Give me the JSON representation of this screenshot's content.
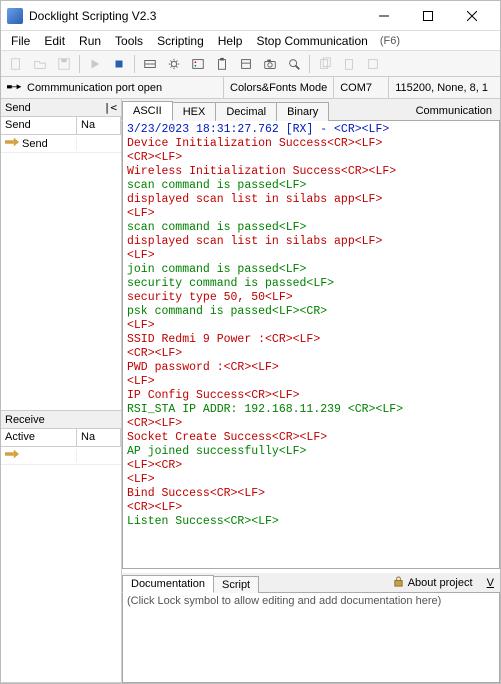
{
  "window": {
    "title": "Docklight Scripting V2.3"
  },
  "menu": {
    "items": [
      "File",
      "Edit",
      "Run",
      "Tools",
      "Scripting",
      "Help"
    ],
    "stop_label": "Stop Communication",
    "stop_hint": "(F6)"
  },
  "status": {
    "port_status": "Commmunication port open",
    "mode_label": "Colors&Fonts Mode",
    "port": "COM7",
    "settings": "115200, None, 8, 1"
  },
  "left": {
    "send": {
      "title": "Send",
      "min_glyph": "|<",
      "col1": "Send",
      "col2": "Na",
      "row1_label": "Send"
    },
    "receive": {
      "title": "Receive",
      "col1": "Active",
      "col2": "Na"
    }
  },
  "tabs": {
    "items": [
      "ASCII",
      "HEX",
      "Decimal",
      "Binary"
    ],
    "active": 0,
    "right_label": "Communication"
  },
  "console_lines": [
    {
      "cls": "c-blue",
      "txt": "3/23/2023 18:31:27.762 [RX] - <CR><LF>"
    },
    {
      "cls": "c-red",
      "txt": "Device Initialization Success<CR><LF>"
    },
    {
      "cls": "c-red",
      "txt": "<CR><LF>"
    },
    {
      "cls": "c-red",
      "txt": "Wireless Initialization Success<CR><LF>"
    },
    {
      "cls": "c-green",
      "txt": "scan command is passed<LF>"
    },
    {
      "cls": "c-red",
      "txt": "displayed scan list in silabs app<LF>"
    },
    {
      "cls": "c-red",
      "txt": "<LF>"
    },
    {
      "cls": "c-green",
      "txt": "scan command is passed<LF>"
    },
    {
      "cls": "c-red",
      "txt": "displayed scan list in silabs app<LF>"
    },
    {
      "cls": "c-red",
      "txt": "<LF>"
    },
    {
      "cls": "c-green",
      "txt": "join command is passed<LF>"
    },
    {
      "cls": "c-green",
      "txt": "security command is passed<LF>"
    },
    {
      "cls": "c-red",
      "txt": "security type 50, 50<LF>"
    },
    {
      "cls": "c-green",
      "txt": "psk command is passed<LF><CR>"
    },
    {
      "cls": "c-red",
      "txt": "<LF>"
    },
    {
      "cls": "c-red",
      "txt": "SSID Redmi 9 Power :<CR><LF>"
    },
    {
      "cls": "c-red",
      "txt": "<CR><LF>"
    },
    {
      "cls": "c-red",
      "txt": "PWD password :<CR><LF>"
    },
    {
      "cls": "c-red",
      "txt": "<LF>"
    },
    {
      "cls": "c-red",
      "txt": "IP Config Success<CR><LF>"
    },
    {
      "cls": "c-green",
      "txt": "RSI_STA IP ADDR: 192.168.11.239 <CR><LF>"
    },
    {
      "cls": "c-red",
      "txt": "<CR><LF>"
    },
    {
      "cls": "c-red",
      "txt": "Socket Create Success<CR><LF>"
    },
    {
      "cls": "c-green",
      "txt": "AP joined successfully<LF>"
    },
    {
      "cls": "c-red",
      "txt": "<LF><CR>"
    },
    {
      "cls": "c-red",
      "txt": "<LF>"
    },
    {
      "cls": "c-red",
      "txt": "Bind Success<CR><LF>"
    },
    {
      "cls": "c-red",
      "txt": "<CR><LF>"
    },
    {
      "cls": "c-green",
      "txt": "Listen Success<CR><LF>"
    }
  ],
  "docs": {
    "tabs": [
      "Documentation",
      "Script"
    ],
    "about": "About project",
    "about_suffix": "V",
    "placeholder": "(Click Lock symbol to allow editing and add documentation here)"
  }
}
